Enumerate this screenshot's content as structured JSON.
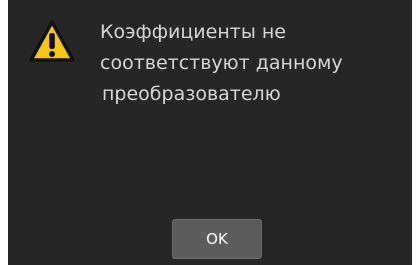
{
  "dialog": {
    "icon": "warning-icon",
    "message_lines": [
      "Коэффициенты не",
      "соответствуют данному",
      "преобразователю"
    ],
    "ok_label": "OK"
  },
  "colors": {
    "background": "#262626",
    "text": "#d6d6d6",
    "warning_fill": "#f5c518",
    "button": "#5c5c5c"
  }
}
